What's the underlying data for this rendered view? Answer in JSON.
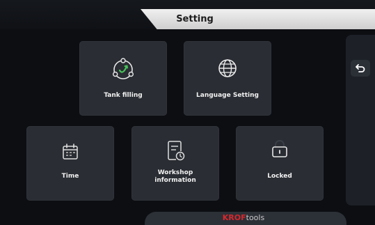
{
  "header": {
    "title": "Setting"
  },
  "tiles": {
    "tank_filling": {
      "label": "Tank filling",
      "icon": "tank-refill-cycle-icon"
    },
    "language": {
      "label": "Language Setting",
      "icon": "globe-icon"
    },
    "time": {
      "label": "Time",
      "icon": "calendar-icon"
    },
    "workshop": {
      "label_line1": "Workshop",
      "label_line2": "information",
      "icon": "document-clock-icon"
    },
    "locked": {
      "label": "Locked",
      "icon": "lock-icon"
    }
  },
  "side_panel": {
    "back_icon": "back-arrow-icon"
  },
  "footer": {
    "brand_primary": "KROF",
    "brand_secondary": "tools"
  },
  "colors": {
    "accent_green": "#49c35a",
    "tile_bg": "#2a2d33",
    "brand_red": "#d8262c",
    "title_bg": "#e6e6e6"
  }
}
